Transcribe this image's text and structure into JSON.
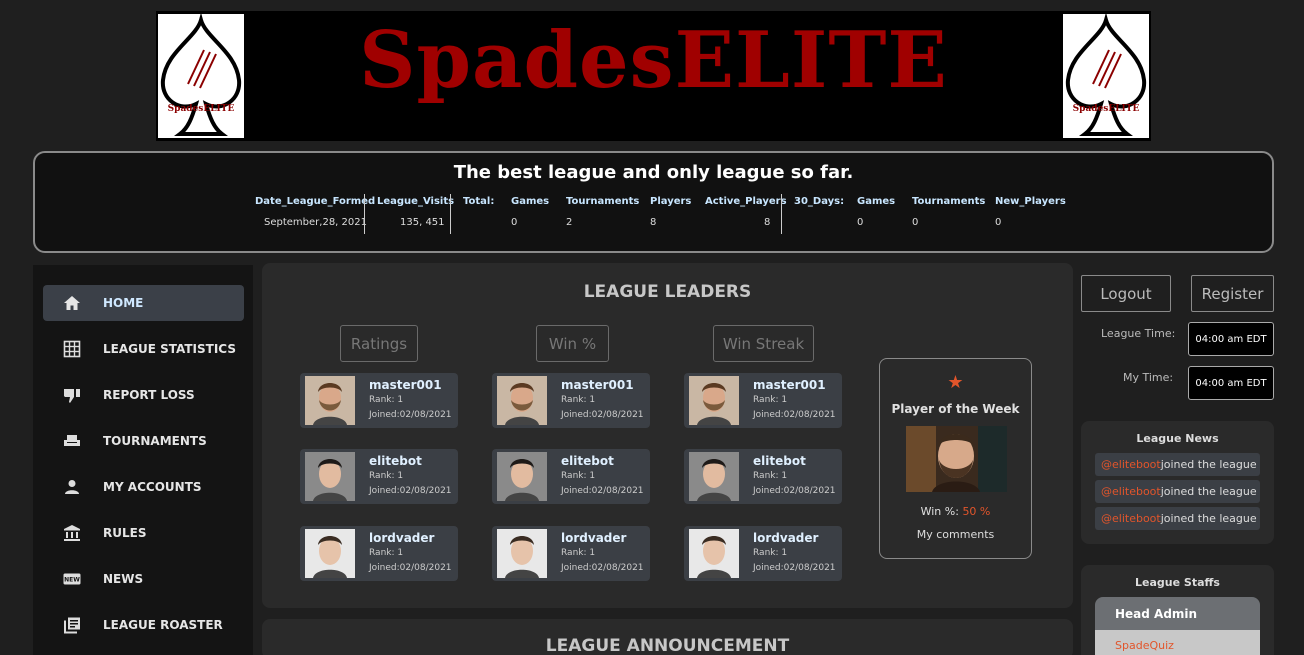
{
  "banner": {
    "title": "SpadesELITE",
    "logo_text": "SpadesELITE"
  },
  "stats": {
    "tagline": "The best league and only league so far.",
    "date_label": "Date_League_Formed",
    "date_value": "September,28, 2021",
    "visits_label": "League_Visits",
    "visits_value": "135, 451",
    "total_label": "Total:",
    "total": [
      {
        "label": "Games",
        "value": "0"
      },
      {
        "label": "Tournaments",
        "value": "2"
      },
      {
        "label": "Players",
        "value": "8"
      },
      {
        "label": "Active_Players",
        "value": "8"
      }
    ],
    "days_label": "30_Days:",
    "days": [
      {
        "label": "Games",
        "value": "0"
      },
      {
        "label": "Tournaments",
        "value": "0"
      },
      {
        "label": "New_Players",
        "value": "0"
      }
    ]
  },
  "sidebar": {
    "items": [
      {
        "label": "HOME",
        "icon": "home-icon"
      },
      {
        "label": "LEAGUE STATISTICS",
        "icon": "grid-icon"
      },
      {
        "label": "REPORT LOSS",
        "icon": "thumbs-down-icon"
      },
      {
        "label": "TOURNAMENTS",
        "icon": "seat-icon"
      },
      {
        "label": "MY ACCOUNTS",
        "icon": "person-icon"
      },
      {
        "label": "RULES",
        "icon": "bank-icon"
      },
      {
        "label": "NEWS",
        "icon": "new-icon"
      },
      {
        "label": "LEAGUE ROASTER",
        "icon": "library-icon"
      }
    ]
  },
  "leaders": {
    "title": "LEAGUE LEADERS",
    "tabs": [
      "Ratings",
      "Win %",
      "Win Streak"
    ],
    "players": [
      {
        "name": "master001",
        "rank": "Rank: 1",
        "joined": "Joined:02/08/2021"
      },
      {
        "name": "elitebot",
        "rank": "Rank: 1",
        "joined": "Joined:02/08/2021"
      },
      {
        "name": "lordvader",
        "rank": "Rank: 1",
        "joined": "Joined:02/08/2021"
      }
    ],
    "potw": {
      "title": "Player of the Week",
      "win_label": "Win %:",
      "win_value": "50 %",
      "comments": "My comments"
    }
  },
  "announcement": {
    "title": "LEAGUE ANNOUNCEMENT"
  },
  "right": {
    "logout": "Logout",
    "register": "Register",
    "league_time_label": "League Time:",
    "league_time": "04:00 am EDT",
    "my_time_label": "My Time:",
    "my_time": "04:00 am EDT",
    "news_title": "League News",
    "news": [
      {
        "who": "@eliteboot",
        "text": " joined the league"
      },
      {
        "who": "@eliteboot",
        "text": " joined the league"
      },
      {
        "who": "@eliteboot",
        "text": " joined the league"
      }
    ],
    "staff_title": "League Staffs",
    "staff_head": "Head Admin",
    "staff_name": "SpadeQuiz"
  },
  "colors": {
    "accent": "#e2552b",
    "brand_red": "#a00000",
    "active_nav": "#3b4048"
  }
}
